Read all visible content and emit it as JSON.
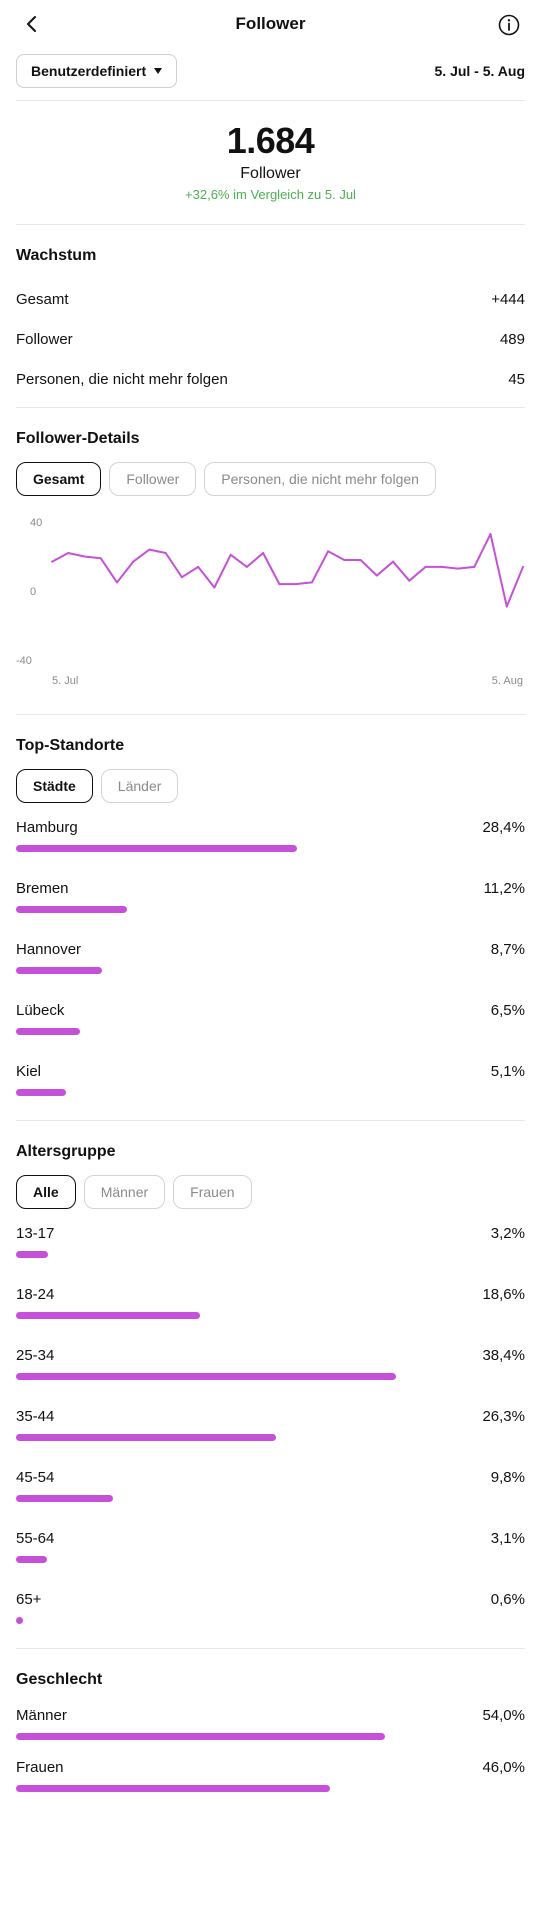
{
  "header": {
    "title": "Follower"
  },
  "controls": {
    "range_label": "Benutzerdefiniert",
    "date_range": "5. Jul - 5. Aug"
  },
  "summary": {
    "total": "1.684",
    "label": "Follower",
    "delta": "+32,6% im Vergleich zu 5. Jul"
  },
  "growth": {
    "title": "Wachstum",
    "rows": [
      {
        "label": "Gesamt",
        "value": "+444"
      },
      {
        "label": "Follower",
        "value": "489"
      },
      {
        "label": "Personen, die nicht mehr folgen",
        "value": "45"
      }
    ]
  },
  "details": {
    "title": "Follower-Details",
    "tabs": [
      "Gesamt",
      "Follower",
      "Personen, die nicht mehr folgen"
    ],
    "active_tab": 0
  },
  "chart_data": {
    "type": "line",
    "title": "",
    "xlabel": "",
    "ylabel": "",
    "x_tick_labels": [
      "5. Jul",
      "5. Aug"
    ],
    "y_tick_labels": [
      "40",
      "0",
      "-40"
    ],
    "ylim": [
      -40,
      40
    ],
    "grid": false,
    "color": "#c651d9",
    "series": [
      {
        "values": [
          17,
          22,
          20,
          19,
          5,
          17,
          24,
          22,
          8,
          14,
          2,
          21,
          14,
          22,
          4,
          4,
          5,
          23,
          18,
          18,
          9,
          17,
          6,
          14,
          14,
          13,
          14,
          33,
          -9,
          14
        ]
      }
    ]
  },
  "locations": {
    "title": "Top-Standorte",
    "tabs": [
      "Städte",
      "Länder"
    ],
    "active_tab": 0,
    "items": [
      {
        "label": "Hamburg",
        "pct": "28,4%",
        "value": 28.4
      },
      {
        "label": "Bremen",
        "pct": "11,2%",
        "value": 11.2
      },
      {
        "label": "Hannover",
        "pct": "8,7%",
        "value": 8.7
      },
      {
        "label": "Lübeck",
        "pct": "6,5%",
        "value": 6.5
      },
      {
        "label": "Kiel",
        "pct": "5,1%",
        "value": 5.1
      }
    ]
  },
  "age": {
    "title": "Altersgruppe",
    "tabs": [
      "Alle",
      "Männer",
      "Frauen"
    ],
    "active_tab": 0,
    "items": [
      {
        "label": "13-17",
        "pct": "3,2%",
        "value": 3.2
      },
      {
        "label": "18-24",
        "pct": "18,6%",
        "value": 18.6
      },
      {
        "label": "25-34",
        "pct": "38,4%",
        "value": 38.4
      },
      {
        "label": "35-44",
        "pct": "26,3%",
        "value": 26.3
      },
      {
        "label": "45-54",
        "pct": "9,8%",
        "value": 9.8
      },
      {
        "label": "55-64",
        "pct": "3,1%",
        "value": 3.1
      },
      {
        "label": "65+",
        "pct": "0,6%",
        "value": 0.6
      }
    ]
  },
  "gender": {
    "title": "Geschlecht",
    "items": [
      {
        "label": "Männer",
        "pct": "54,0%",
        "value": 54.0
      },
      {
        "label": "Frauen",
        "pct": "46,0%",
        "value": 46.0
      }
    ]
  }
}
